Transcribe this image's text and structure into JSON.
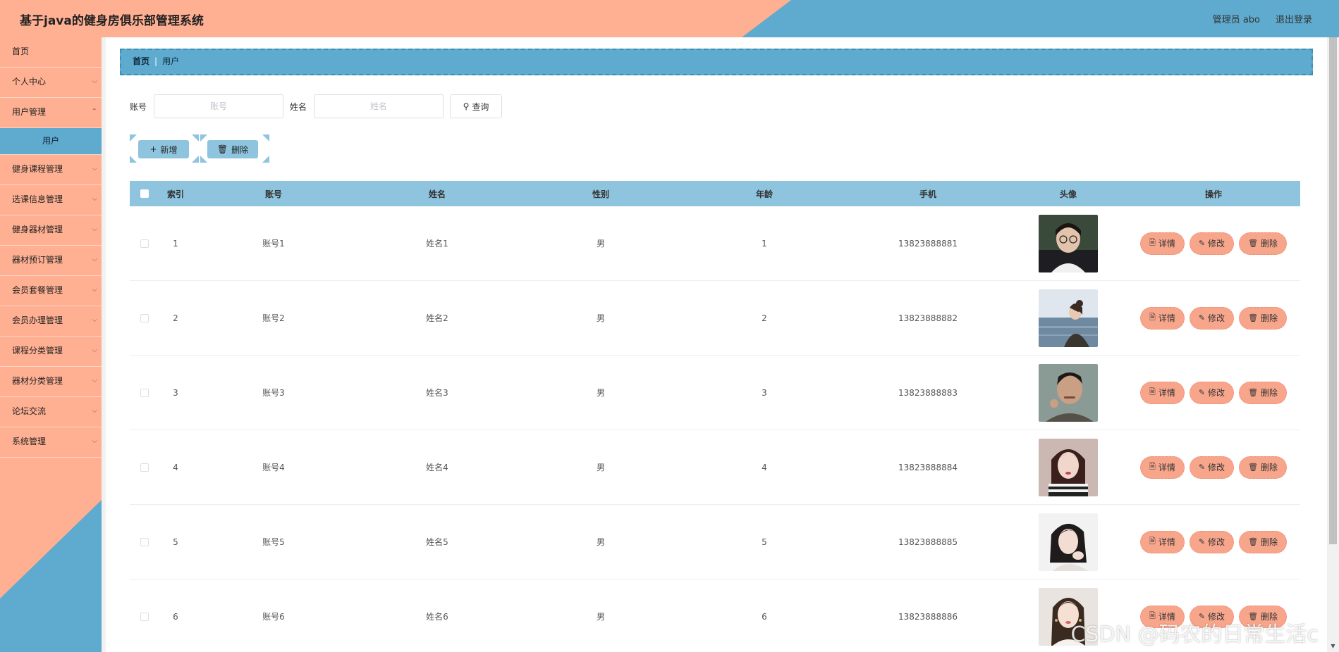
{
  "header": {
    "title": "基于java的健身房俱乐部管理系统",
    "user": "管理员 abo",
    "logout": "退出登录"
  },
  "colors": {
    "accent_orange": "#ffb092",
    "accent_blue": "#5eabcf",
    "table_header": "#8ec4de",
    "op_button": "#f7a68c"
  },
  "sidebar": {
    "items": [
      {
        "label": "首页"
      },
      {
        "label": "个人中心"
      },
      {
        "label": "用户管理"
      },
      {
        "label": "用户"
      },
      {
        "label": "健身课程管理"
      },
      {
        "label": "选课信息管理"
      },
      {
        "label": "健身器材管理"
      },
      {
        "label": "器材预订管理"
      },
      {
        "label": "会员套餐管理"
      },
      {
        "label": "会员办理管理"
      },
      {
        "label": "课程分类管理"
      },
      {
        "label": "器材分类管理"
      },
      {
        "label": "论坛交流"
      },
      {
        "label": "系统管理"
      }
    ]
  },
  "breadcrumb": {
    "home": "首页",
    "separator": "|",
    "current": "用户"
  },
  "search": {
    "account_label": "账号",
    "account_placeholder": "账号",
    "name_label": "姓名",
    "name_placeholder": "姓名",
    "query_label": "查询",
    "query_icon": "search-icon"
  },
  "actions": {
    "add_label": "新增",
    "delete_label": "删除"
  },
  "table": {
    "headers": [
      "索引",
      "账号",
      "姓名",
      "性别",
      "年龄",
      "手机",
      "头像",
      "操作"
    ],
    "op_labels": {
      "detail": "详情",
      "edit": "修改",
      "delete": "删除"
    },
    "rows": [
      {
        "index": "1",
        "account": "账号1",
        "name": "姓名1",
        "sex": "男",
        "age": "1",
        "phone": "13823888881"
      },
      {
        "index": "2",
        "account": "账号2",
        "name": "姓名2",
        "sex": "男",
        "age": "2",
        "phone": "13823888882"
      },
      {
        "index": "3",
        "account": "账号3",
        "name": "姓名3",
        "sex": "男",
        "age": "3",
        "phone": "13823888883"
      },
      {
        "index": "4",
        "account": "账号4",
        "name": "姓名4",
        "sex": "男",
        "age": "4",
        "phone": "13823888884"
      },
      {
        "index": "5",
        "account": "账号5",
        "name": "姓名5",
        "sex": "男",
        "age": "5",
        "phone": "13823888885"
      },
      {
        "index": "6",
        "account": "账号6",
        "name": "姓名6",
        "sex": "男",
        "age": "6",
        "phone": "13823888886"
      }
    ]
  },
  "watermark": "CSDN @码农的日常生活c"
}
